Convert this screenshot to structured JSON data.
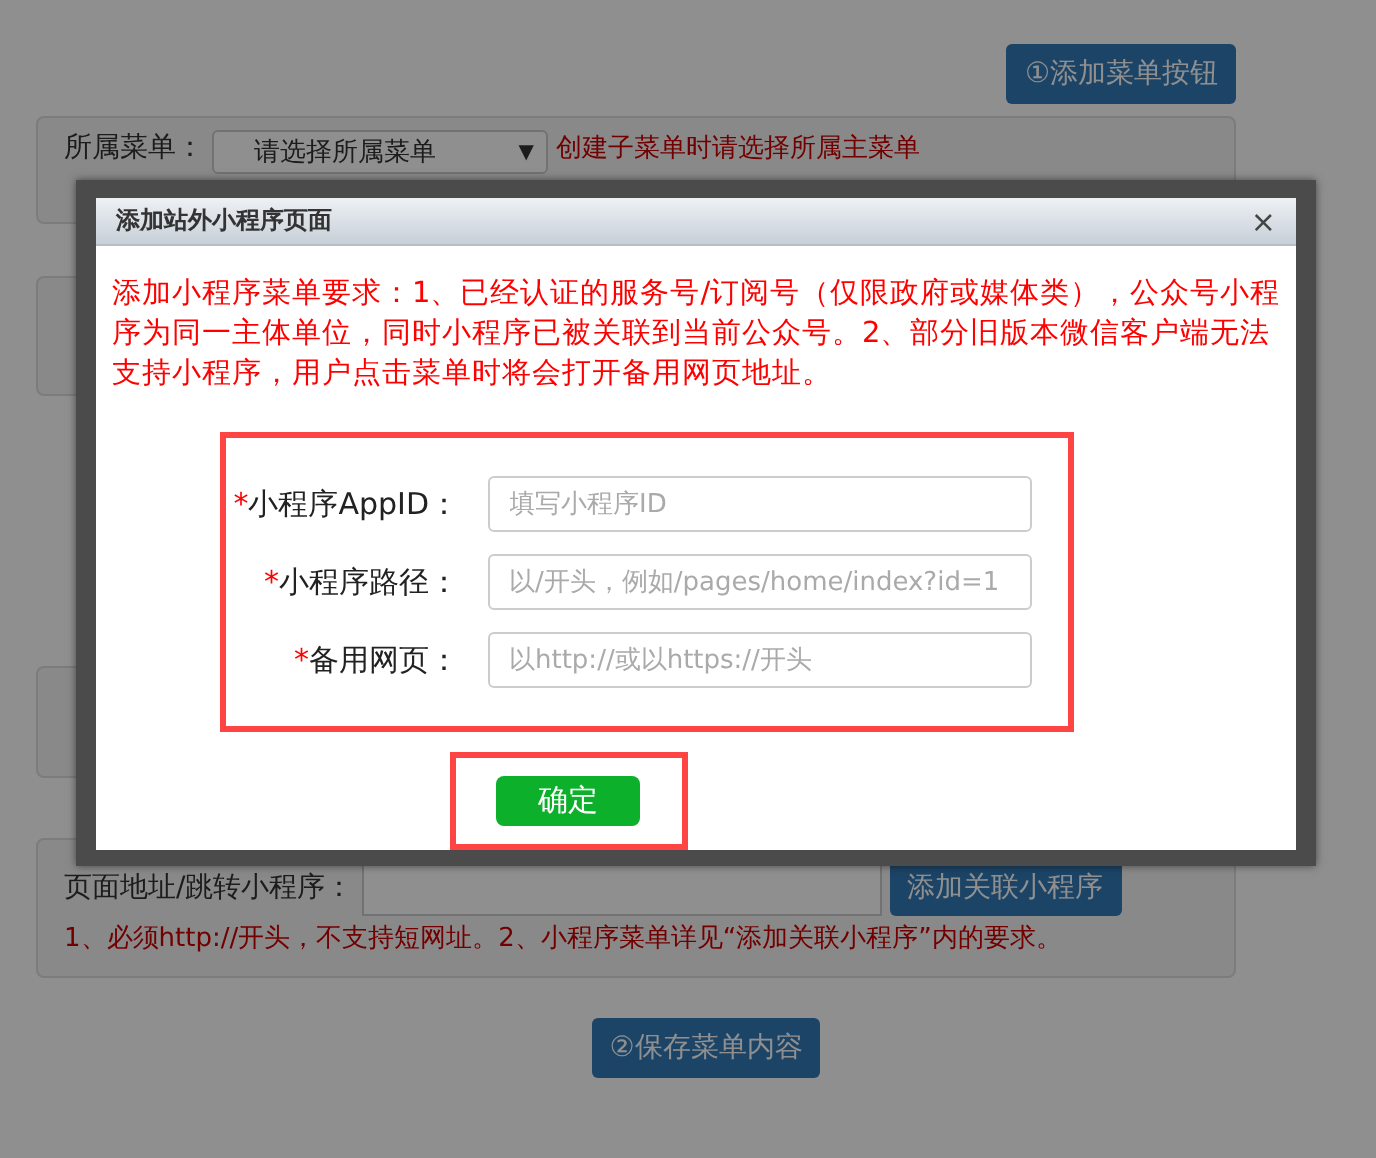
{
  "page": {
    "add_menu_button": "①添加菜单按钮",
    "parent_menu": {
      "label": "所属菜单：",
      "select_value": "请选择所属菜单",
      "caret": "▼",
      "hint": "创建子菜单时请选择所属主菜单"
    },
    "page_address": {
      "label": "页面地址/跳转小程序：",
      "button": "添加关联小程序",
      "note": "1、必须http://开头，不支持短网址。2、小程序菜单详见“添加关联小程序”内的要求。"
    },
    "save_button": "②保存菜单内容"
  },
  "dialog": {
    "title": "添加站外小程序页面",
    "close": "×",
    "notice": "添加小程序菜单要求：1、已经认证的服务号/订阅号（仅限政府或媒体类），公众号小程序为同一主体单位，同时小程序已被关联到当前公众号。2、部分旧版本微信客户端无法支持小程序，用户点击菜单时将会打开备用网页地址。",
    "fields": [
      {
        "required": "*",
        "label": "小程序AppID：",
        "placeholder": "填写小程序ID"
      },
      {
        "required": "*",
        "label": "小程序路径：",
        "placeholder": "以/开头，例如/pages/home/index?id=1"
      },
      {
        "required": "*",
        "label": "备用网页：",
        "placeholder": "以http://或以https://开头"
      }
    ],
    "confirm": "确定"
  }
}
